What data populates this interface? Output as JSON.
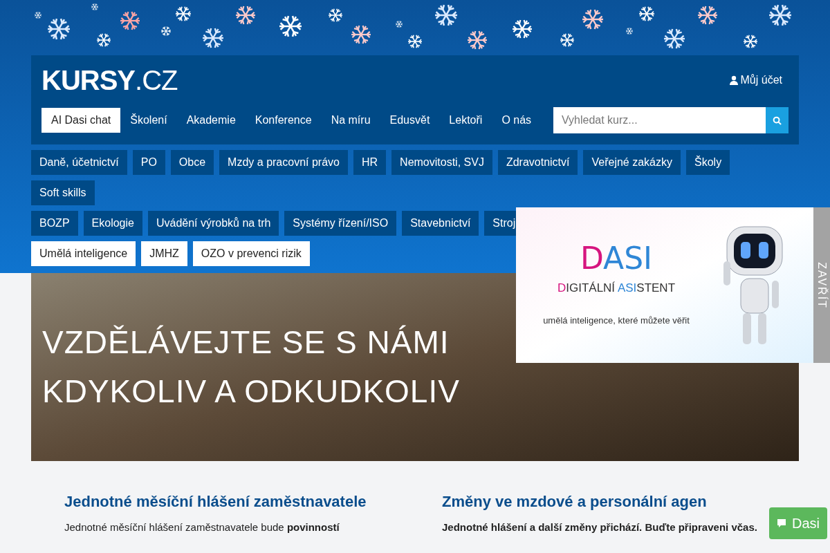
{
  "logo": {
    "text": "KURSY",
    "suffix": ".CZ"
  },
  "account": {
    "label": "Můj účet"
  },
  "nav": [
    {
      "label": "AI Dasi chat",
      "selected": true
    },
    {
      "label": "Školení",
      "selected": false
    },
    {
      "label": "Akademie",
      "selected": false
    },
    {
      "label": "Konference",
      "selected": false
    },
    {
      "label": "Na míru",
      "selected": false
    },
    {
      "label": "Edusvět",
      "selected": false
    },
    {
      "label": "Lektoři",
      "selected": false
    },
    {
      "label": "O nás",
      "selected": false
    }
  ],
  "search": {
    "placeholder": "Vyhledat kurz..."
  },
  "category_rows": [
    [
      {
        "label": "Daně, účetnictví",
        "selected": false
      },
      {
        "label": "PO",
        "selected": false
      },
      {
        "label": "Obce",
        "selected": false
      },
      {
        "label": "Mzdy a pracovní právo",
        "selected": false
      },
      {
        "label": "HR",
        "selected": false
      },
      {
        "label": "Nemovitosti, SVJ",
        "selected": false
      },
      {
        "label": "Zdravotnictví",
        "selected": false
      },
      {
        "label": "Veřejné zakázky",
        "selected": false
      },
      {
        "label": "Školy",
        "selected": false
      },
      {
        "label": "Soft skills",
        "selected": false
      }
    ],
    [
      {
        "label": "BOZP",
        "selected": false
      },
      {
        "label": "Ekologie",
        "selected": false
      },
      {
        "label": "Uvádění výrobků na trh",
        "selected": false
      },
      {
        "label": "Systémy řízení/ISO",
        "selected": false
      },
      {
        "label": "Stavebnictví",
        "selected": false
      },
      {
        "label": "Stroj",
        "selected": false
      }
    ],
    [
      {
        "label": "Umělá inteligence",
        "selected": true
      },
      {
        "label": "JMHZ",
        "selected": true
      },
      {
        "label": "OZO v prevenci rizik",
        "selected": true
      }
    ]
  ],
  "hero": {
    "lines": [
      "VZDĚLÁVEJTE SE S NÁMI",
      "KDYKOLIV A ODKUDKOLIV"
    ]
  },
  "popup": {
    "title_first": "D",
    "title_rest": "ASI",
    "subtitle_parts": [
      "D",
      "IGITÁLNÍ ",
      "ASI",
      "STENT"
    ],
    "tagline": "umělá inteligence, které můžete věřit",
    "close_label": "ZAVŘÍT"
  },
  "articles": [
    {
      "title": "Jednotné měsíční hlášení zaměstnavatele",
      "text": "Jednotné měsíční hlášení zaměstnavatele bude **povinností**"
    },
    {
      "title": "Změny ve mzdové a personální agen",
      "text": "**Jednotné hlášení a další změny přichází. Buďte připraveni včas.**"
    }
  ],
  "chat_button": {
    "label": "Dasi"
  }
}
